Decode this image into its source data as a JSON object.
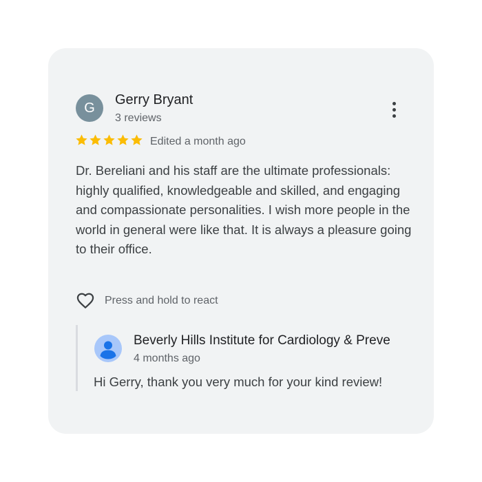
{
  "review": {
    "author": {
      "initial": "G",
      "name": "Gerry Bryant",
      "review_count": "3 reviews",
      "avatar_color": "#78909c"
    },
    "menu_icon": "more-vert-icon",
    "rating": 5,
    "rating_max": 5,
    "star_color": "#fbbc04",
    "edited_time": "Edited a month ago",
    "text": "Dr. Bereliani and his staff are the ultimate professionals: highly qualified, knowledgeable and skilled, and engaging and compassionate personalities. I wish more people in the world in general were like that. It is always a pleasure going to their office.",
    "react": {
      "icon": "heart-outline-icon",
      "label": "Press and hold to react"
    }
  },
  "owner_reply": {
    "avatar_icon": "person-avatar-icon",
    "name": "Beverly Hills Institute for Cardiology & Preve",
    "time": "4 months ago",
    "text": "Hi Gerry, thank you very much for your kind review!"
  },
  "colors": {
    "card_background": "#f1f3f4",
    "text_primary": "#202124",
    "text_secondary": "#5f6368",
    "owner_avatar_bg": "#a8c7fa",
    "owner_avatar_fg": "#1a73e8"
  }
}
